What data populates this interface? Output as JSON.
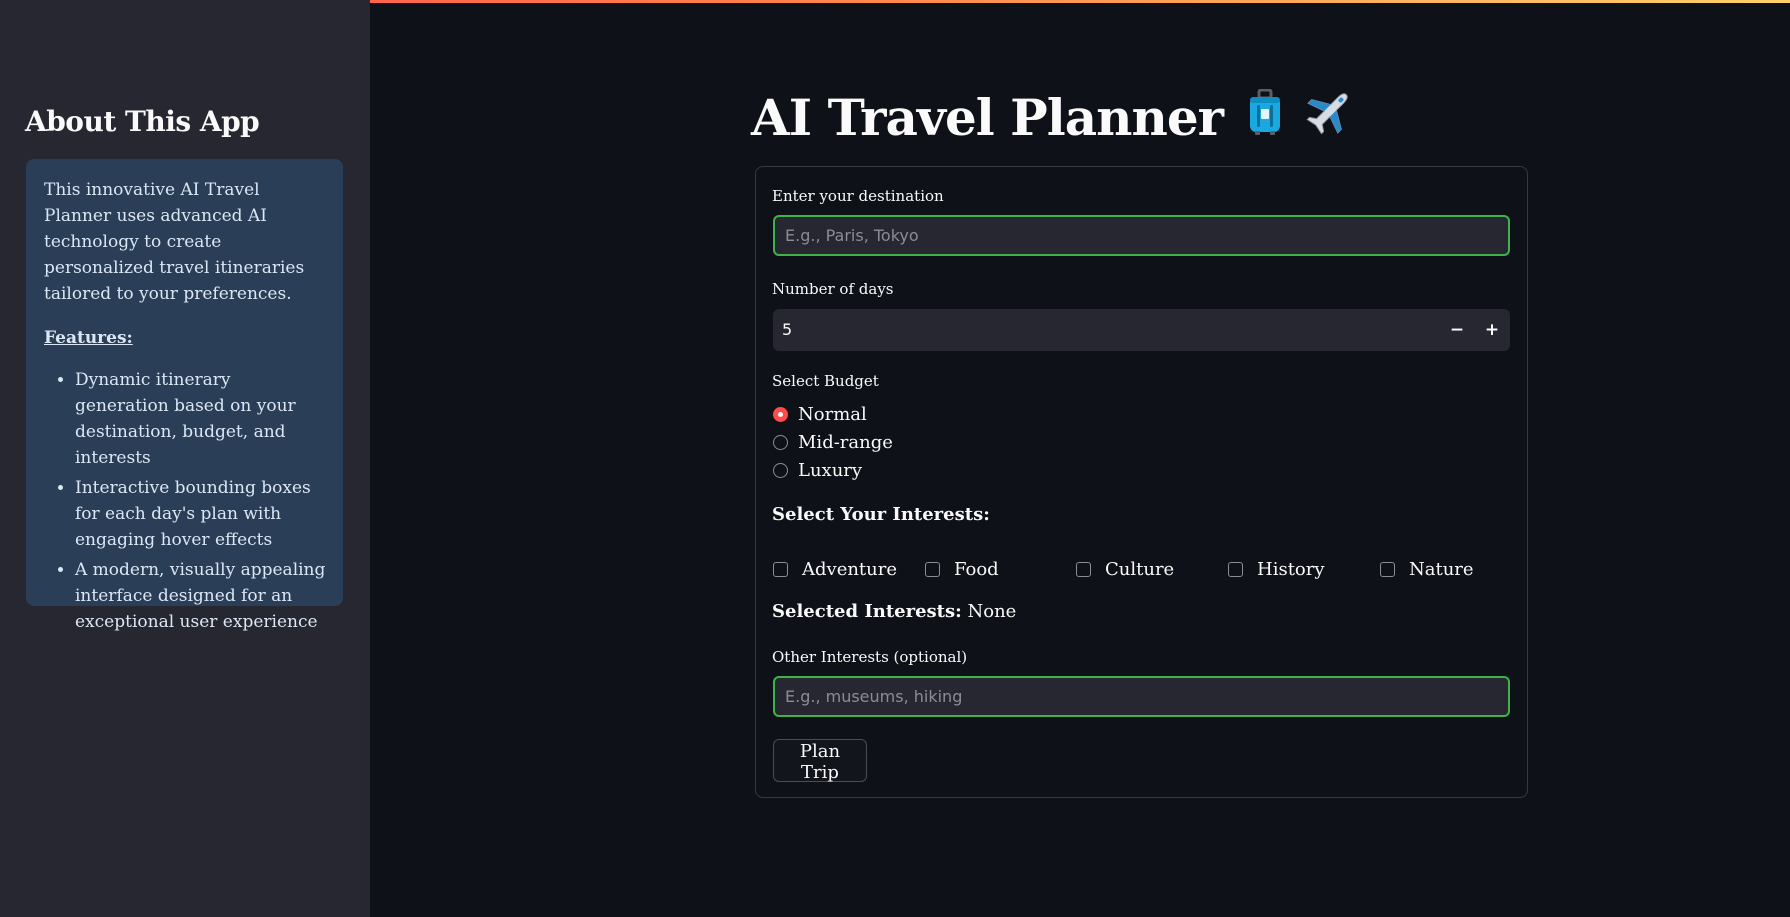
{
  "sidebar": {
    "heading": "About This App",
    "about_text": "This innovative AI Travel Planner uses advanced AI technology to create personalized travel itineraries tailored to your preferences.",
    "features_title": "Features:",
    "features": [
      "Dynamic itinerary generation based on your destination, budget, and interests",
      "Interactive bounding boxes for each day's plan with engaging hover effects",
      "A modern, visually appealing interface designed for an exceptional user experience"
    ]
  },
  "main": {
    "title": "AI Travel Planner",
    "title_icons": [
      "luggage-icon",
      "airplane-icon"
    ]
  },
  "form": {
    "destination": {
      "label": "Enter your destination",
      "value": "",
      "placeholder": "E.g., Paris, Tokyo"
    },
    "days": {
      "label": "Number of days",
      "value": "5",
      "decrement": "−",
      "increment": "+"
    },
    "budget": {
      "label": "Select Budget",
      "options": [
        "Normal",
        "Mid-range",
        "Luxury"
      ],
      "selected": "Normal"
    },
    "interests": {
      "title": "Select Your Interests:",
      "options": [
        "Adventure",
        "Food",
        "Culture",
        "History",
        "Nature"
      ],
      "selected_label": "Selected Interests:",
      "selected_value": "None"
    },
    "other_interests": {
      "label": "Other Interests (optional)",
      "value": "",
      "placeholder": "E.g., museums, hiking"
    },
    "submit_label": "Plan Trip"
  },
  "colors": {
    "background": "#0e1117",
    "sidebar": "#262730",
    "info_box": "#2b3e57",
    "accent": "#ff4b4b",
    "focus_border": "#3eb34a"
  }
}
